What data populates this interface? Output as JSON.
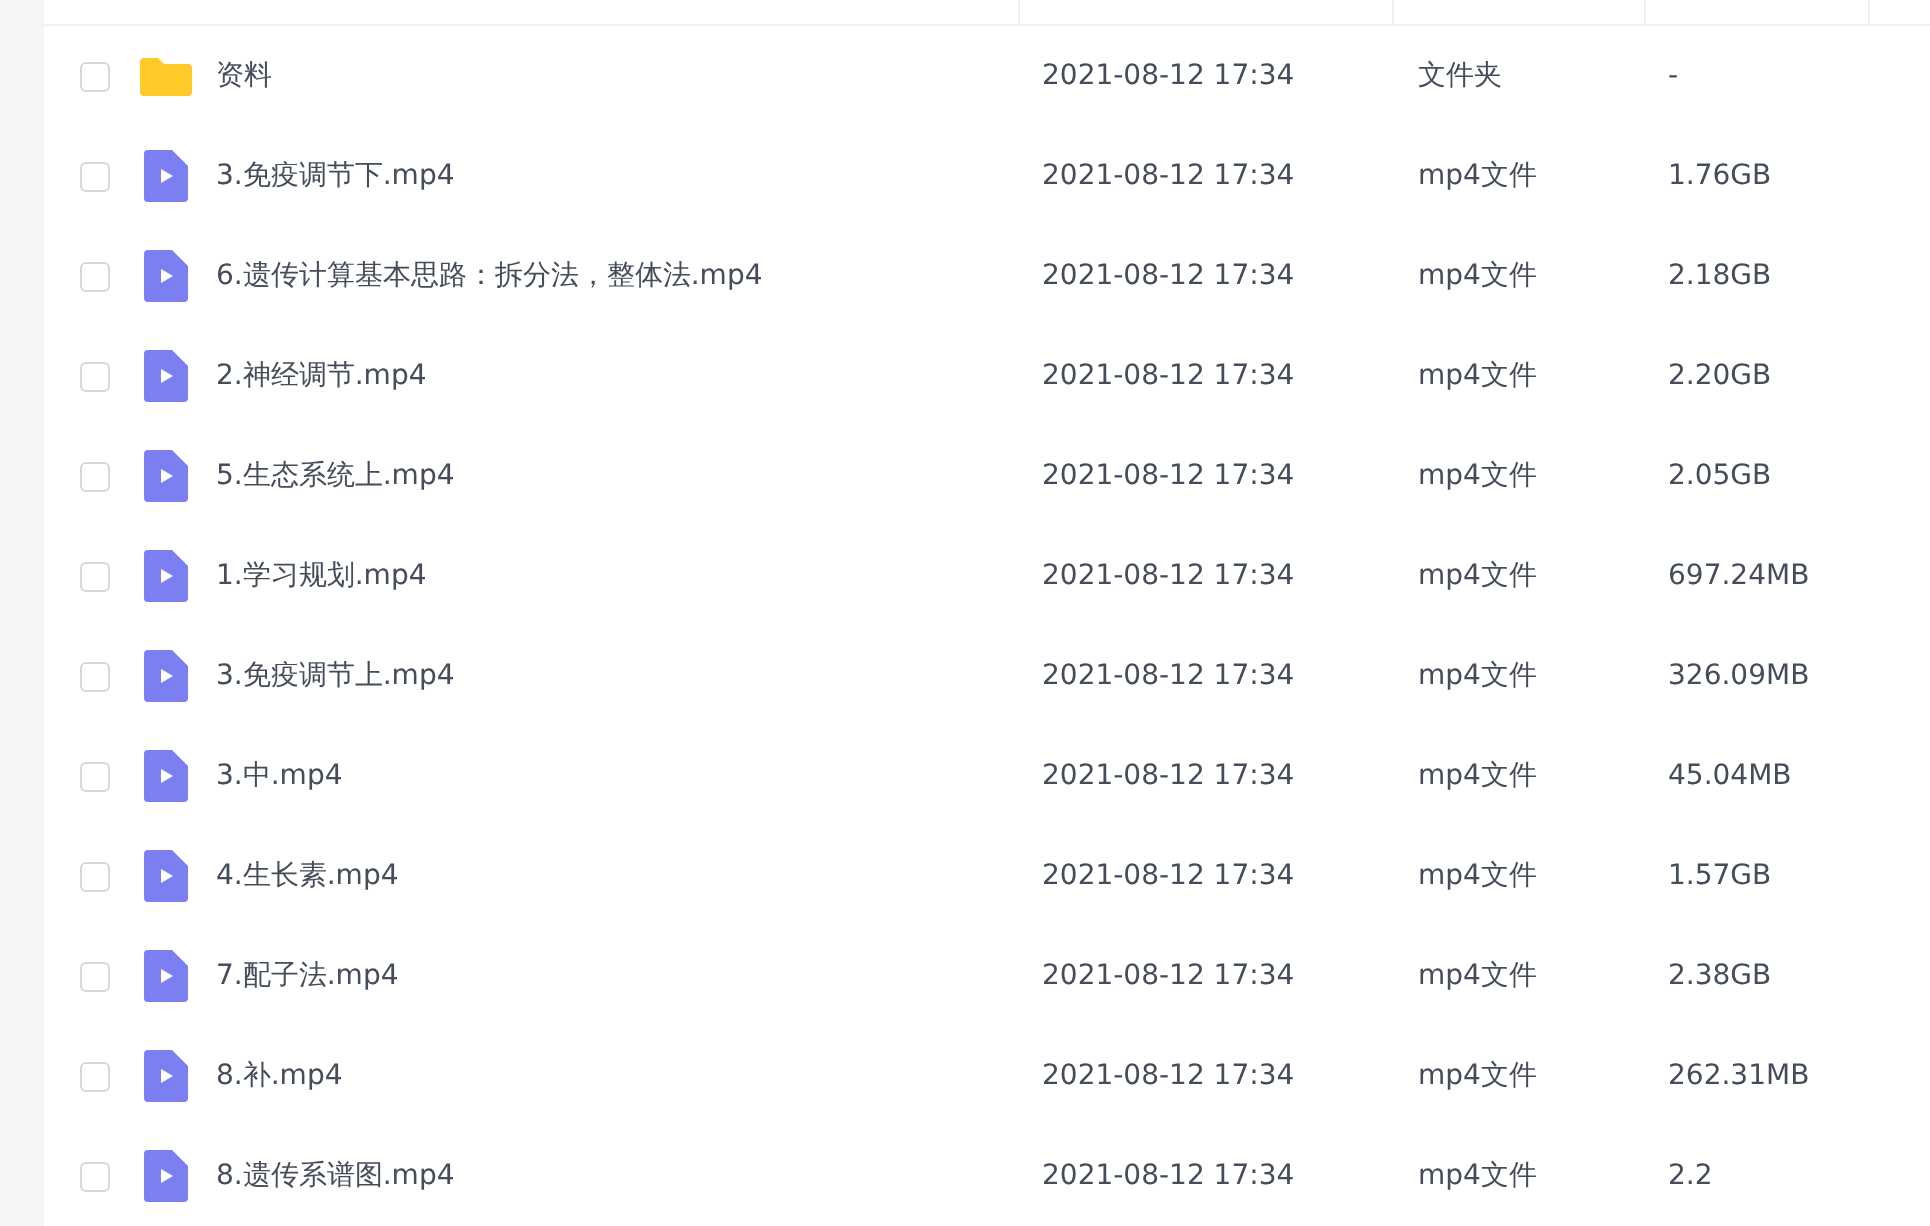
{
  "files": [
    {
      "kind": "folder",
      "name": "资料",
      "modified": "2021-08-12 17:34",
      "type": "文件夹",
      "size": "-",
      "checked": false
    },
    {
      "kind": "video",
      "name": "3.免疫调节下.mp4",
      "modified": "2021-08-12 17:34",
      "type": "mp4文件",
      "size": "1.76GB",
      "checked": false
    },
    {
      "kind": "video",
      "name": "6.遗传计算基本思路：拆分法，整体法.mp4",
      "modified": "2021-08-12 17:34",
      "type": "mp4文件",
      "size": "2.18GB",
      "checked": false
    },
    {
      "kind": "video",
      "name": "2.神经调节.mp4",
      "modified": "2021-08-12 17:34",
      "type": "mp4文件",
      "size": "2.20GB",
      "checked": false
    },
    {
      "kind": "video",
      "name": "5.生态系统上.mp4",
      "modified": "2021-08-12 17:34",
      "type": "mp4文件",
      "size": "2.05GB",
      "checked": false
    },
    {
      "kind": "video",
      "name": "1.学习规划.mp4",
      "modified": "2021-08-12 17:34",
      "type": "mp4文件",
      "size": "697.24MB",
      "checked": false
    },
    {
      "kind": "video",
      "name": "3.免疫调节上.mp4",
      "modified": "2021-08-12 17:34",
      "type": "mp4文件",
      "size": "326.09MB",
      "checked": false
    },
    {
      "kind": "video",
      "name": "3.中.mp4",
      "modified": "2021-08-12 17:34",
      "type": "mp4文件",
      "size": "45.04MB",
      "checked": false
    },
    {
      "kind": "video",
      "name": "4.生长素.mp4",
      "modified": "2021-08-12 17:34",
      "type": "mp4文件",
      "size": "1.57GB",
      "checked": false
    },
    {
      "kind": "video",
      "name": "7.配子法.mp4",
      "modified": "2021-08-12 17:34",
      "type": "mp4文件",
      "size": "2.38GB",
      "checked": false
    },
    {
      "kind": "video",
      "name": "8.补.mp4",
      "modified": "2021-08-12 17:34",
      "type": "mp4文件",
      "size": "262.31MB",
      "checked": false
    },
    {
      "kind": "video",
      "name": "8.遗传系谱图.mp4",
      "modified": "2021-08-12 17:34",
      "type": "mp4文件",
      "size": "2.2",
      "checked": false
    }
  ]
}
